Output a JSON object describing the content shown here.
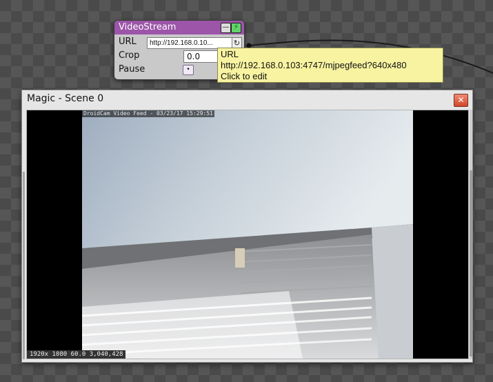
{
  "node": {
    "title": "VideoStream",
    "min_icon": "minus-icon",
    "bolt_icon": "lightning-icon",
    "fields": {
      "url_label": "URL",
      "url_value": "http://192.168.0.10...",
      "crop_label": "Crop",
      "crop_value": "0.0",
      "pause_label": "Pause"
    },
    "refresh_glyph": "↻",
    "pause_glyph": "•"
  },
  "tooltip": {
    "line1": "URL",
    "line2": "http://192.168.0.103:4747/mjpegfeed?640x480",
    "line3": "Click to edit"
  },
  "window": {
    "title": "Magic - Scene 0",
    "close_glyph": "✕",
    "feed_top_text": "DroidCam Video Feed - 03/23/17 15:29:51",
    "feed_bottom_text": "1920x 1080  60.0  3,040,428"
  },
  "colors": {
    "node_header": "#9c55a8",
    "bolt_button": "#62d36b",
    "tooltip_bg": "#f7f3a0",
    "close_button": "#d2452a"
  }
}
